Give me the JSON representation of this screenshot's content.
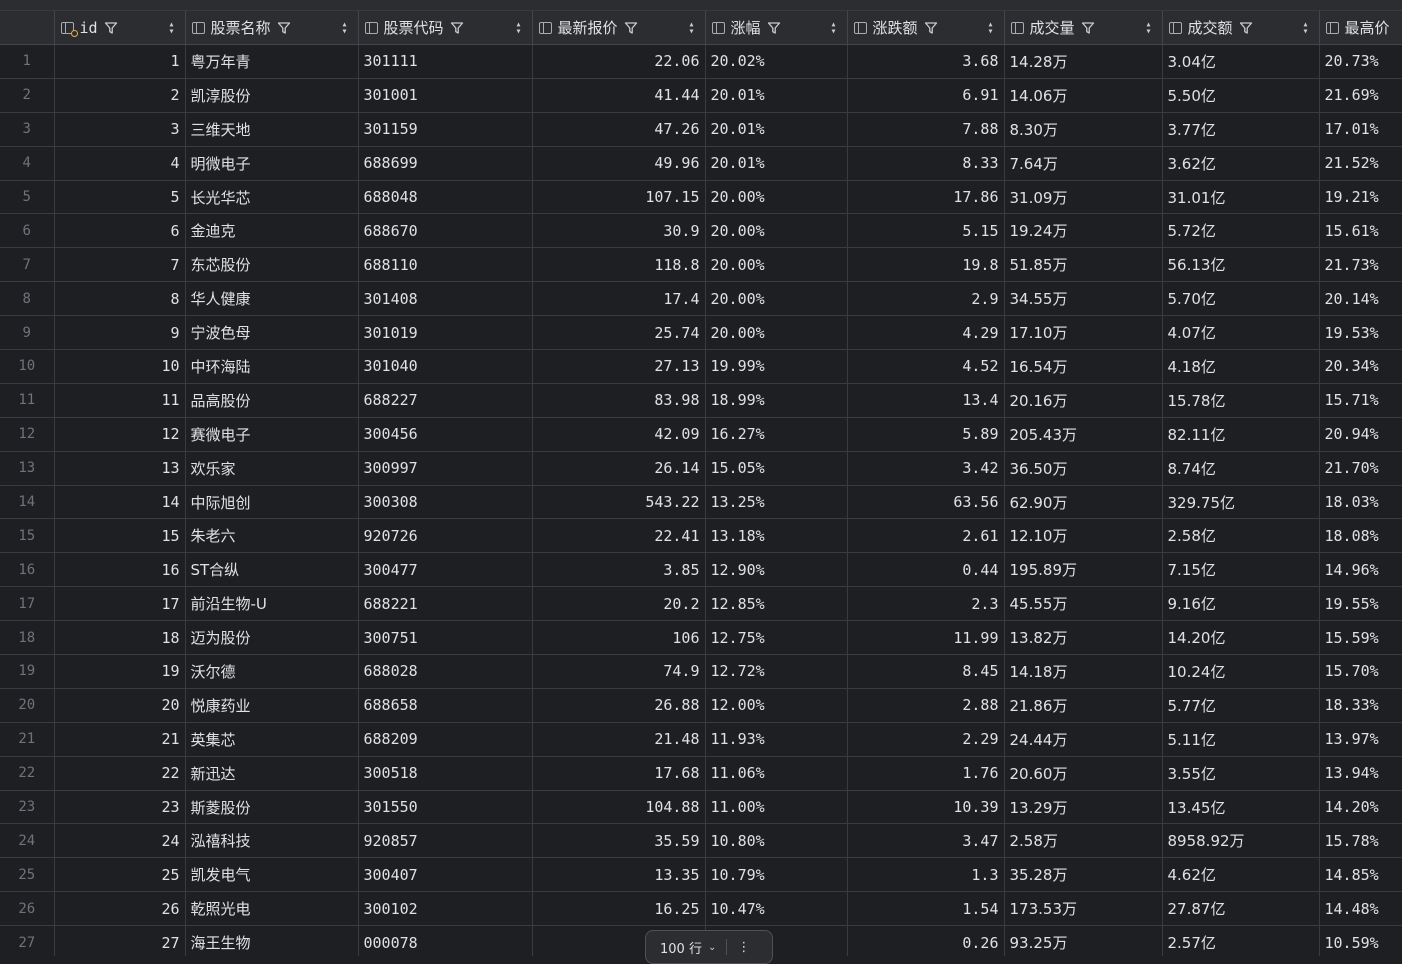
{
  "headers": [
    {
      "key": "id",
      "label": "id",
      "is_key": true
    },
    {
      "key": "name",
      "label": "股票名称"
    },
    {
      "key": "code",
      "label": "股票代码"
    },
    {
      "key": "price",
      "label": "最新报价"
    },
    {
      "key": "pct",
      "label": "涨幅"
    },
    {
      "key": "chg",
      "label": "涨跌额"
    },
    {
      "key": "vol",
      "label": "成交量"
    },
    {
      "key": "turnover",
      "label": "成交额"
    },
    {
      "key": "high",
      "label": "最高价"
    }
  ],
  "rows": [
    {
      "n": "1",
      "id": "1",
      "name": "粤万年青",
      "code": "301111",
      "price": "22.06",
      "pct": "20.02%",
      "chg": "3.68",
      "vol": "14.28万",
      "turnover": "3.04亿",
      "high": "20.73%"
    },
    {
      "n": "2",
      "id": "2",
      "name": "凯淳股份",
      "code": "301001",
      "price": "41.44",
      "pct": "20.01%",
      "chg": "6.91",
      "vol": "14.06万",
      "turnover": "5.50亿",
      "high": "21.69%"
    },
    {
      "n": "3",
      "id": "3",
      "name": "三维天地",
      "code": "301159",
      "price": "47.26",
      "pct": "20.01%",
      "chg": "7.88",
      "vol": "8.30万",
      "turnover": "3.77亿",
      "high": "17.01%"
    },
    {
      "n": "4",
      "id": "4",
      "name": "明微电子",
      "code": "688699",
      "price": "49.96",
      "pct": "20.01%",
      "chg": "8.33",
      "vol": "7.64万",
      "turnover": "3.62亿",
      "high": "21.52%"
    },
    {
      "n": "5",
      "id": "5",
      "name": "长光华芯",
      "code": "688048",
      "price": "107.15",
      "pct": "20.00%",
      "chg": "17.86",
      "vol": "31.09万",
      "turnover": "31.01亿",
      "high": "19.21%"
    },
    {
      "n": "6",
      "id": "6",
      "name": "金迪克",
      "code": "688670",
      "price": "30.9",
      "pct": "20.00%",
      "chg": "5.15",
      "vol": "19.24万",
      "turnover": "5.72亿",
      "high": "15.61%"
    },
    {
      "n": "7",
      "id": "7",
      "name": "东芯股份",
      "code": "688110",
      "price": "118.8",
      "pct": "20.00%",
      "chg": "19.8",
      "vol": "51.85万",
      "turnover": "56.13亿",
      "high": "21.73%"
    },
    {
      "n": "8",
      "id": "8",
      "name": "华人健康",
      "code": "301408",
      "price": "17.4",
      "pct": "20.00%",
      "chg": "2.9",
      "vol": "34.55万",
      "turnover": "5.70亿",
      "high": "20.14%"
    },
    {
      "n": "9",
      "id": "9",
      "name": "宁波色母",
      "code": "301019",
      "price": "25.74",
      "pct": "20.00%",
      "chg": "4.29",
      "vol": "17.10万",
      "turnover": "4.07亿",
      "high": "19.53%"
    },
    {
      "n": "10",
      "id": "10",
      "name": "中环海陆",
      "code": "301040",
      "price": "27.13",
      "pct": "19.99%",
      "chg": "4.52",
      "vol": "16.54万",
      "turnover": "4.18亿",
      "high": "20.34%"
    },
    {
      "n": "11",
      "id": "11",
      "name": "品高股份",
      "code": "688227",
      "price": "83.98",
      "pct": "18.99%",
      "chg": "13.4",
      "vol": "20.16万",
      "turnover": "15.78亿",
      "high": "15.71%"
    },
    {
      "n": "12",
      "id": "12",
      "name": "赛微电子",
      "code": "300456",
      "price": "42.09",
      "pct": "16.27%",
      "chg": "5.89",
      "vol": "205.43万",
      "turnover": "82.11亿",
      "high": "20.94%"
    },
    {
      "n": "13",
      "id": "13",
      "name": "欢乐家",
      "code": "300997",
      "price": "26.14",
      "pct": "15.05%",
      "chg": "3.42",
      "vol": "36.50万",
      "turnover": "8.74亿",
      "high": "21.70%"
    },
    {
      "n": "14",
      "id": "14",
      "name": "中际旭创",
      "code": "300308",
      "price": "543.22",
      "pct": "13.25%",
      "chg": "63.56",
      "vol": "62.90万",
      "turnover": "329.75亿",
      "high": "18.03%"
    },
    {
      "n": "15",
      "id": "15",
      "name": "朱老六",
      "code": "920726",
      "price": "22.41",
      "pct": "13.18%",
      "chg": "2.61",
      "vol": "12.10万",
      "turnover": "2.58亿",
      "high": "18.08%"
    },
    {
      "n": "16",
      "id": "16",
      "name": "ST合纵",
      "code": "300477",
      "price": "3.85",
      "pct": "12.90%",
      "chg": "0.44",
      "vol": "195.89万",
      "turnover": "7.15亿",
      "high": "14.96%"
    },
    {
      "n": "17",
      "id": "17",
      "name": "前沿生物-U",
      "code": "688221",
      "price": "20.2",
      "pct": "12.85%",
      "chg": "2.3",
      "vol": "45.55万",
      "turnover": "9.16亿",
      "high": "19.55%"
    },
    {
      "n": "18",
      "id": "18",
      "name": "迈为股份",
      "code": "300751",
      "price": "106",
      "pct": "12.75%",
      "chg": "11.99",
      "vol": "13.82万",
      "turnover": "14.20亿",
      "high": "15.59%"
    },
    {
      "n": "19",
      "id": "19",
      "name": "沃尔德",
      "code": "688028",
      "price": "74.9",
      "pct": "12.72%",
      "chg": "8.45",
      "vol": "14.18万",
      "turnover": "10.24亿",
      "high": "15.70%"
    },
    {
      "n": "20",
      "id": "20",
      "name": "悦康药业",
      "code": "688658",
      "price": "26.88",
      "pct": "12.00%",
      "chg": "2.88",
      "vol": "21.86万",
      "turnover": "5.77亿",
      "high": "18.33%"
    },
    {
      "n": "21",
      "id": "21",
      "name": "英集芯",
      "code": "688209",
      "price": "21.48",
      "pct": "11.93%",
      "chg": "2.29",
      "vol": "24.44万",
      "turnover": "5.11亿",
      "high": "13.97%"
    },
    {
      "n": "22",
      "id": "22",
      "name": "新迅达",
      "code": "300518",
      "price": "17.68",
      "pct": "11.06%",
      "chg": "1.76",
      "vol": "20.60万",
      "turnover": "3.55亿",
      "high": "13.94%"
    },
    {
      "n": "23",
      "id": "23",
      "name": "斯菱股份",
      "code": "301550",
      "price": "104.88",
      "pct": "11.00%",
      "chg": "10.39",
      "vol": "13.29万",
      "turnover": "13.45亿",
      "high": "14.20%"
    },
    {
      "n": "24",
      "id": "24",
      "name": "泓禧科技",
      "code": "920857",
      "price": "35.59",
      "pct": "10.80%",
      "chg": "3.47",
      "vol": "2.58万",
      "turnover": "8958.92万",
      "high": "15.78%"
    },
    {
      "n": "25",
      "id": "25",
      "name": "凯发电气",
      "code": "300407",
      "price": "13.35",
      "pct": "10.79%",
      "chg": "1.3",
      "vol": "35.28万",
      "turnover": "4.62亿",
      "high": "14.85%"
    },
    {
      "n": "26",
      "id": "26",
      "name": "乾照光电",
      "code": "300102",
      "price": "16.25",
      "pct": "10.47%",
      "chg": "1.54",
      "vol": "173.53万",
      "turnover": "27.87亿",
      "high": "14.48%"
    },
    {
      "n": "27",
      "id": "27",
      "name": "海王生物",
      "code": "000078",
      "price": "",
      "pct": "",
      "chg": "0.26",
      "vol": "93.25万",
      "turnover": "2.57亿",
      "high": "10.59%"
    }
  ],
  "pager": {
    "label": "100 行",
    "more": "⋮"
  },
  "colors": {
    "bg": "#1e1f22",
    "header_bg": "#2b2d30",
    "grid": "#393b40",
    "key_icon": "#e3b341"
  }
}
